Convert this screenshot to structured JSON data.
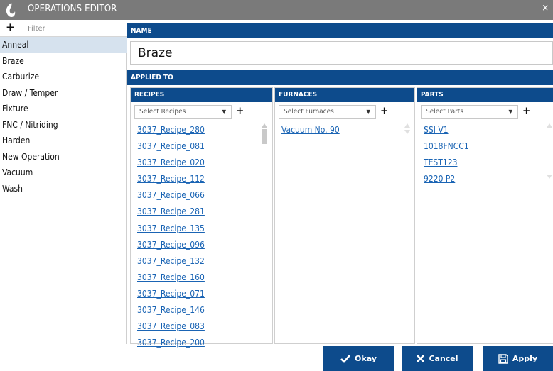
{
  "window": {
    "title": "OPERATIONS EDITOR",
    "close_glyph": "×"
  },
  "sidebar": {
    "add_glyph": "+",
    "filter_placeholder": "Filter",
    "items": [
      {
        "label": "Anneal",
        "selected": true
      },
      {
        "label": "Braze",
        "selected": false
      },
      {
        "label": "Carburize",
        "selected": false
      },
      {
        "label": "Draw / Temper",
        "selected": false
      },
      {
        "label": "Fixture",
        "selected": false
      },
      {
        "label": "FNC / Nitriding",
        "selected": false
      },
      {
        "label": "Harden",
        "selected": false
      },
      {
        "label": "New Operation",
        "selected": false
      },
      {
        "label": "Vacuum",
        "selected": false
      },
      {
        "label": "Wash",
        "selected": false
      }
    ]
  },
  "name_section": {
    "header": "NAME",
    "value": "Braze"
  },
  "applied_section": {
    "header": "APPLIED TO",
    "recipes": {
      "header": "RECIPES",
      "select_placeholder": "Select Recipes",
      "add_glyph": "+",
      "items": [
        "3037_Recipe_280",
        "3037_Recipe_081",
        "3037_Recipe_020",
        "3037_Recipe_112",
        "3037_Recipe_066",
        "3037_Recipe_281",
        "3037_Recipe_135",
        "3037_Recipe_096",
        "3037_Recipe_132",
        "3037_Recipe_160",
        "3037_Recipe_071",
        "3037_Recipe_146",
        "3037_Recipe_083",
        "3037_Recipe_200"
      ]
    },
    "furnaces": {
      "header": "FURNACES",
      "select_placeholder": "Select Furnaces",
      "add_glyph": "+",
      "items": [
        "Vacuum No. 90"
      ]
    },
    "parts": {
      "header": "PARTS",
      "select_placeholder": "Select Parts",
      "add_glyph": "+",
      "items": [
        "SSI V1",
        "1018FNCC1",
        "TEST123",
        "9220 P2"
      ]
    }
  },
  "footer": {
    "okay_label": "Okay",
    "cancel_label": "Cancel",
    "apply_label": "Apply"
  },
  "colors": {
    "header_blue": "#0d4b8c",
    "link_blue": "#1a64b4",
    "titlebar_gray": "#7a7a7a",
    "selected_bg": "#d6e2ee"
  },
  "icons": {
    "logo": "flame-icon",
    "okay": "check-icon",
    "cancel": "x-icon",
    "apply": "save-icon"
  }
}
